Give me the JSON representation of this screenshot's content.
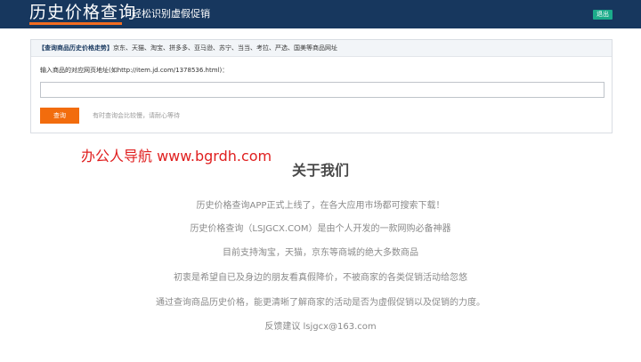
{
  "header": {
    "logo": "历史价格查询",
    "slogan": "轻松识别虚假促销",
    "logout_label": "退出",
    "accent_color": "#f26c21",
    "bg_color": "#17375e"
  },
  "query_panel": {
    "title_bold": "【查询商品历史价格走势】",
    "title_rest": "京东、天猫、淘宝、拼多多、亚马逊、苏宁、当当、考拉、严选、国美等商品网址",
    "field_label": "输入商品的对应网页地址(如http://item.jd.com/1378536.html)：",
    "input_value": "",
    "input_placeholder": "",
    "button_label": "查询",
    "hint": "有时查询会比较慢，请耐心等待"
  },
  "watermark": "办公人导航  www.bgrdh.com",
  "about": {
    "title": "关于我们",
    "lines": [
      "历史价格查询APP正式上线了，在各大应用市场都可搜索下载！",
      "历史价格查询（LSJGCX.COM）是由个人开发的一款网购必备神器",
      "目前支持淘宝，天猫，京东等商城的绝大多数商品",
      "初衷是希望自已及身边的朋友看真假降价，不被商家的各类促销活动给忽悠",
      "通过查询商品历史价格，能更清晰了解商家的活动是否为虚假促销以及促销的力度。",
      "反馈建议 lsjgcx@163.com"
    ]
  }
}
